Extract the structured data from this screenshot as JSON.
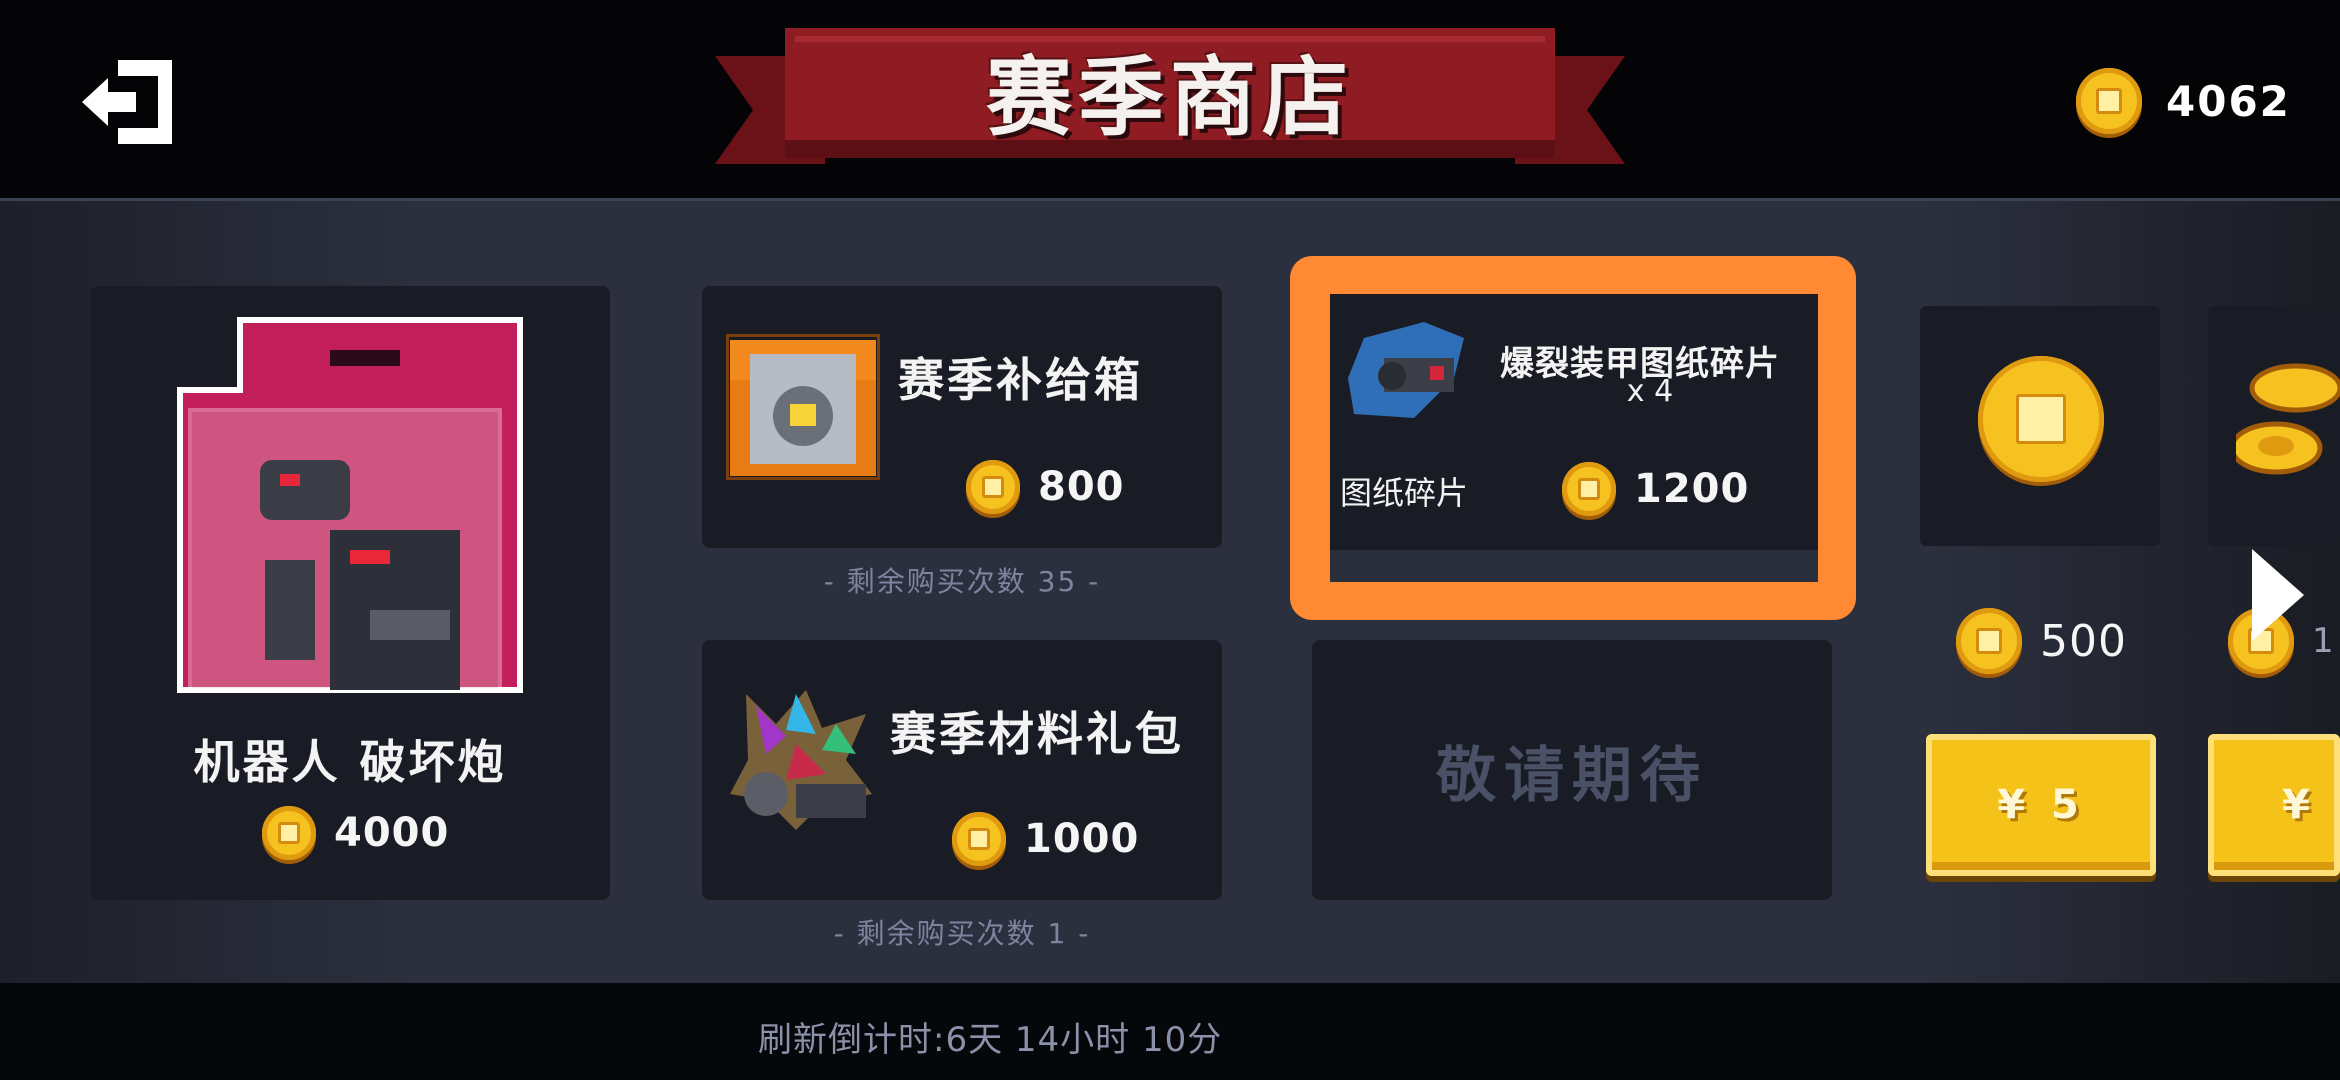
{
  "header": {
    "title": "赛季商店",
    "currency_amount": "4062"
  },
  "items": {
    "robot": {
      "name": "机器人 破坏炮",
      "price": "4000"
    },
    "supply_box": {
      "name": "赛季补给箱",
      "price": "800",
      "remaining": "- 剩余购买次数 35 -"
    },
    "blueprint": {
      "name_line1": "爆裂装甲图纸碎片",
      "name_line2": "x 4",
      "category": "图纸碎片",
      "price": "1200"
    },
    "material_pack": {
      "name": "赛季材料礼包",
      "price": "1000",
      "remaining": "- 剩余购买次数 1 -"
    },
    "coming_soon": "敬请期待"
  },
  "coin_packs": [
    {
      "amount": "500",
      "button": "¥ 5"
    },
    {
      "amount": "1",
      "button": "¥"
    }
  ],
  "footer": {
    "refresh": "刷新倒计时:6天 14小时 10分"
  },
  "colors": {
    "highlight": "#ff8a33",
    "banner": "#8e1c22",
    "coin": "#f6c21f",
    "button": "#f4c219"
  }
}
